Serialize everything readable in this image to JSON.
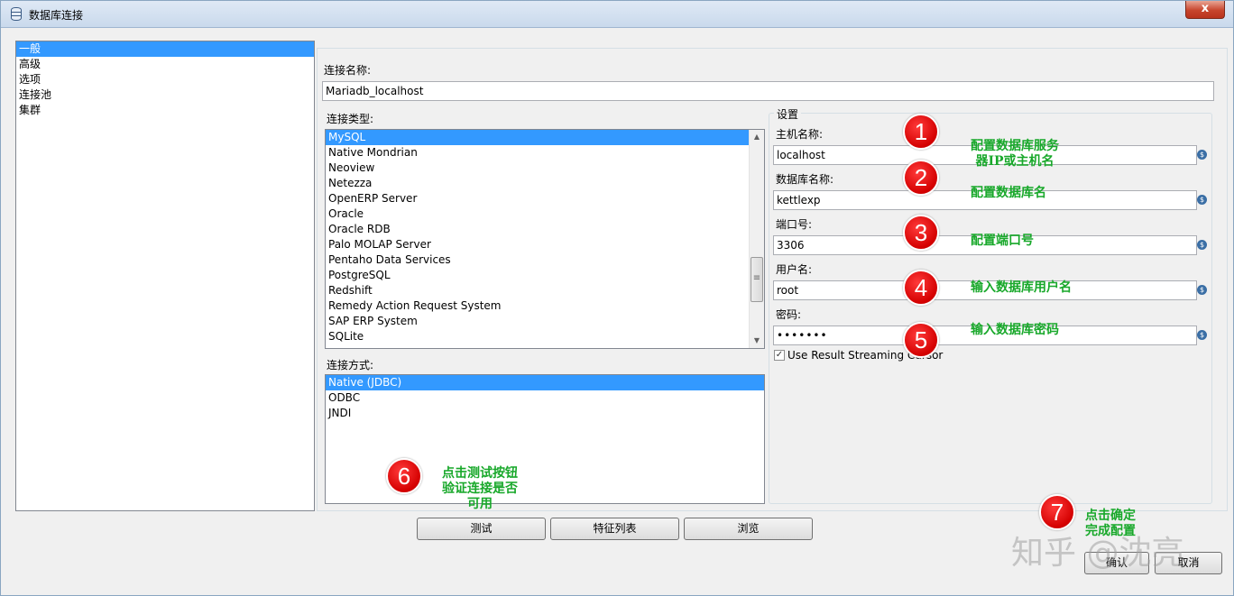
{
  "window": {
    "title": "数据库连接",
    "close_label": "x"
  },
  "sidebar": {
    "items": [
      {
        "label": "一般",
        "selected": true
      },
      {
        "label": "高级"
      },
      {
        "label": "选项"
      },
      {
        "label": "连接池"
      },
      {
        "label": "集群"
      }
    ]
  },
  "connection_name": {
    "label": "连接名称:",
    "value": "Mariadb_localhost"
  },
  "connection_type": {
    "label": "连接类型:",
    "items": [
      "MySQL",
      "Native Mondrian",
      "Neoview",
      "Netezza",
      "OpenERP Server",
      "Oracle",
      "Oracle RDB",
      "Palo MOLAP Server",
      "Pentaho Data Services",
      "PostgreSQL",
      "Redshift",
      "Remedy Action Request System",
      "SAP ERP System",
      "SQLite"
    ],
    "selected": "MySQL"
  },
  "access_method": {
    "label": "连接方式:",
    "items": [
      "Native (JDBC)",
      "ODBC",
      "JNDI"
    ],
    "selected": "Native (JDBC)"
  },
  "settings": {
    "group_label": "设置",
    "host": {
      "label": "主机名称:",
      "value": "localhost"
    },
    "database": {
      "label": "数据库名称:",
      "value": "kettlexp"
    },
    "port": {
      "label": "端口号:",
      "value": "3306"
    },
    "user": {
      "label": "用户名:",
      "value": "root"
    },
    "password": {
      "label": "密码:",
      "value": "•••••••"
    },
    "streaming_cursor": {
      "label": "Use Result Streaming Cursor",
      "checked": true
    },
    "variable_icon": "$"
  },
  "buttons": {
    "test": "测试",
    "feature_list": "特征列表",
    "browse": "浏览",
    "ok": "确认",
    "cancel": "取消"
  },
  "annotations": [
    {
      "number": "1",
      "text_line1": "配置数据库服务",
      "text_line2": "器IP或主机名"
    },
    {
      "number": "2",
      "text_line1": "配置数据库名"
    },
    {
      "number": "3",
      "text_line1": "配置端口号"
    },
    {
      "number": "4",
      "text_line1": "输入数据库用户名"
    },
    {
      "number": "5",
      "text_line1": "输入数据库密码"
    },
    {
      "number": "6",
      "text_line1": "点击测试按钮",
      "text_line2": "验证连接是否",
      "text_line3": "可用"
    },
    {
      "number": "7",
      "text_line1": "点击确定",
      "text_line2": "完成配置"
    }
  ],
  "watermark": "知乎 @沈亮",
  "colors": {
    "selection": "#3399ff",
    "badge": "#d40000",
    "note": "#18a82a"
  }
}
